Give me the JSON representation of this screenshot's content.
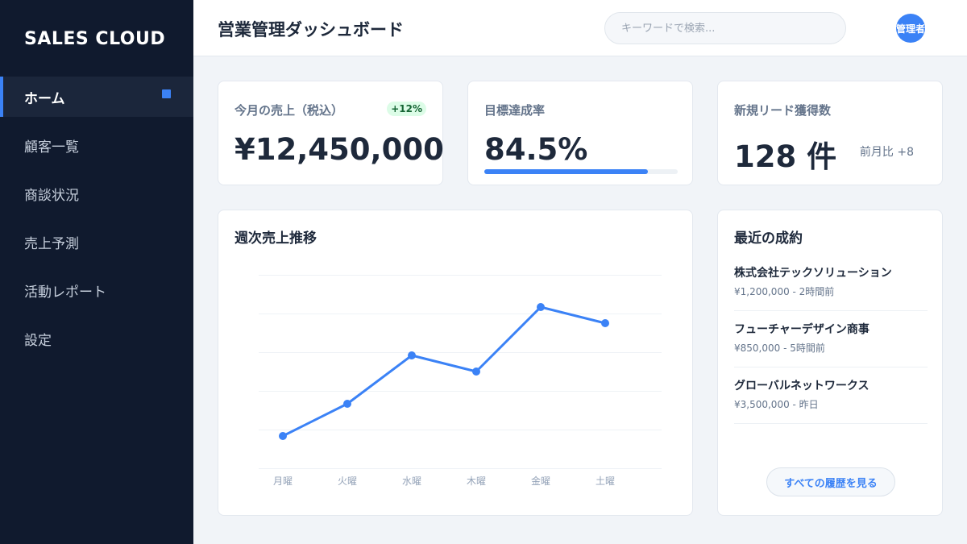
{
  "sidebar": {
    "logo": "SALES CLOUD",
    "items": [
      {
        "label": "ホーム",
        "active": true
      },
      {
        "label": "顧客一覧"
      },
      {
        "label": "商談状況"
      },
      {
        "label": "売上予測"
      },
      {
        "label": "活動レポート"
      },
      {
        "label": "設定"
      }
    ]
  },
  "header": {
    "title": "営業管理ダッシュボード",
    "search_placeholder": "キーワードで検索...",
    "avatar_label": "管理者"
  },
  "kpis": {
    "sales": {
      "label": "今月の売上（税込）",
      "value": "¥12,450,000",
      "badge": "+12%"
    },
    "goal": {
      "label": "目標達成率",
      "value": "84.5%",
      "progress": 0.845
    },
    "leads": {
      "label": "新規リード獲得数",
      "value": "128 件",
      "note": "前月比 +8"
    }
  },
  "colors": {
    "accent": "#3b82f6",
    "sidebar_bg": "#101a2e",
    "badge_bg": "#dcfce7",
    "badge_text": "#166534"
  },
  "chart_data": {
    "type": "line",
    "title": "週次売上推移",
    "categories": [
      "月曜",
      "火曜",
      "水曜",
      "木曜",
      "金曜",
      "土曜"
    ],
    "series": [
      {
        "values": [
          10,
          20,
          35,
          30,
          50,
          45
        ]
      }
    ],
    "ylim": [
      0,
      60
    ],
    "grid": true,
    "legend": "none"
  },
  "recent_deals": {
    "title": "最近の成約",
    "items": [
      {
        "name": "株式会社テックソリューション",
        "meta": "¥1,200,000 - 2時間前"
      },
      {
        "name": "フューチャーデザイン商事",
        "meta": "¥850,000 - 5時間前"
      },
      {
        "name": "グローバルネットワークス",
        "meta": "¥3,500,000 - 昨日"
      }
    ],
    "button_label": "すべての履歴を見る"
  }
}
